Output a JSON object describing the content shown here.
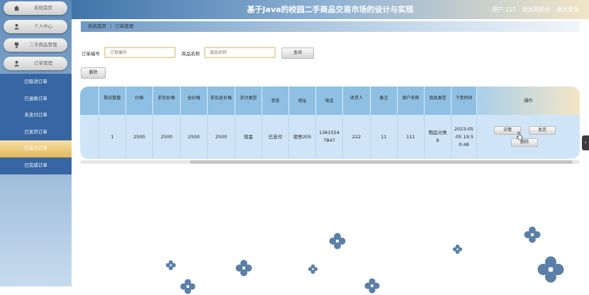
{
  "header": {
    "title": "基于Java的校园二手商品交易市场的设计与实现",
    "user_label": "用户 111",
    "back_link": "退出到前台",
    "logout_link": "退出登录"
  },
  "sidebar": {
    "top_items": [
      {
        "label": "系统首页",
        "icon": "home-icon"
      },
      {
        "label": "个人中心",
        "icon": "person-icon"
      },
      {
        "label": "二手商品管理",
        "icon": "trophy-icon"
      },
      {
        "label": "订单管理",
        "icon": "person-icon"
      }
    ],
    "sub_items": [
      {
        "label": "已取消订单",
        "active": false
      },
      {
        "label": "已退款订单",
        "active": false
      },
      {
        "label": "未支付订单",
        "active": false
      },
      {
        "label": "已发货订单",
        "active": false
      },
      {
        "label": "已支付订单",
        "active": true
      },
      {
        "label": "已完成订单",
        "active": false
      }
    ]
  },
  "breadcrumb": {
    "home": "系统首页",
    "separator": "|",
    "current": "订单管理"
  },
  "search": {
    "order_no_label": "订单编号",
    "order_no_placeholder": "订单编号",
    "product_name_label": "商品名称",
    "product_name_placeholder": "商品名称",
    "query_button": "查询",
    "delete_button": "删除"
  },
  "table": {
    "columns": [
      "购买数量",
      "价格",
      "折扣价格",
      "总价格",
      "折扣总价格",
      "支付类型",
      "状态",
      "地址",
      "电话",
      "收货人",
      "备注",
      "商户名称",
      "商品类型",
      "下单时间",
      "操作"
    ],
    "sort_icon": "sort-icon",
    "row": {
      "quantity": "1",
      "price": "2500",
      "discount_price": "2500",
      "total_price": "2500",
      "discount_total": "2500",
      "pay_type": "现金",
      "status": "已支付",
      "address": "宿舍205",
      "phone": "13615547847",
      "receiver": "222",
      "remark": "11",
      "merchant": "111",
      "product_type": "物品分类8",
      "order_time": "2023-05-05 19:50:48"
    },
    "actions": {
      "detail": "详情",
      "ship": "发货",
      "delete": "删除"
    }
  },
  "colors": {
    "sidebar_blue": "#3766a3",
    "active_gold": "#e3b75c",
    "header_blue": "#3f74aa",
    "clover": "#5a7fa8"
  }
}
